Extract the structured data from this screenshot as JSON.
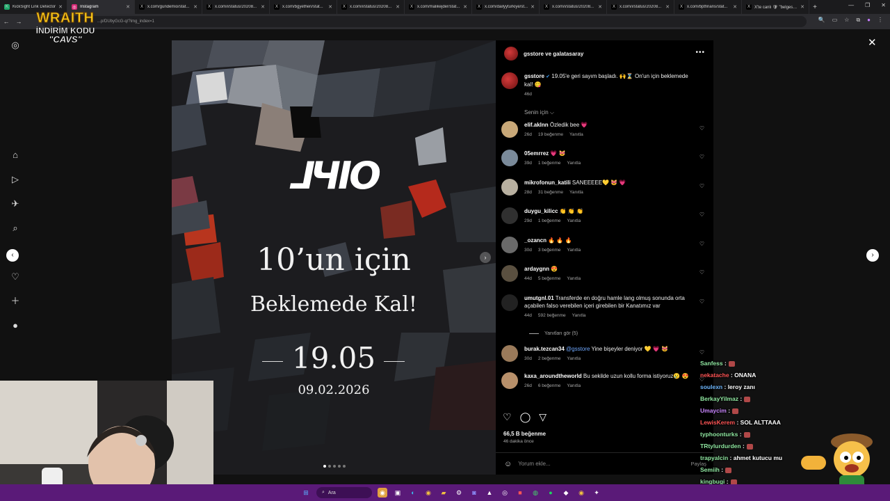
{
  "browser": {
    "tabs": [
      {
        "title": "KickSight Link Detector",
        "fav": "K",
        "color": "#1ea86a"
      },
      {
        "title": "Instagram",
        "fav": "◎",
        "color": "#d62976",
        "active": true
      },
      {
        "title": "x.com/gundemio/stat...",
        "fav": "X",
        "color": "#000000"
      },
      {
        "title": "x.com/i/status/20208...",
        "fav": "X",
        "color": "#000000"
      },
      {
        "title": "x.com/bgyethen/stat...",
        "fav": "X",
        "color": "#000000"
      },
      {
        "title": "x.com/i/status/20208...",
        "fav": "X",
        "color": "#000000"
      },
      {
        "title": "x.com/malikejder/stat...",
        "fav": "X",
        "color": "#000000"
      },
      {
        "title": "x.com/dailyyturkiye/st...",
        "fav": "X",
        "color": "#000000"
      },
      {
        "title": "x.com/i/status/20208...",
        "fav": "X",
        "color": "#000000"
      },
      {
        "title": "x.com/i/status/20208...",
        "fav": "X",
        "color": "#000000"
      },
      {
        "title": "x.com/bptfinans/stat...",
        "fav": "X",
        "color": "#000000"
      },
      {
        "title": "X'te canlı 🛡 \"belgese...",
        "fav": "X",
        "color": "#000000"
      }
    ],
    "url": "...p/DUbyGcG-q/?img_index=1"
  },
  "overlay_brand": {
    "line1": "WRAITH",
    "line2": "İNDİRİM KODU",
    "line3": "\"CAVS\""
  },
  "post_image": {
    "line1": "10’un için",
    "line2": "Beklemede Kal!",
    "date": "19.05",
    "subdate": "09.02.2026"
  },
  "panel": {
    "header": "gsstore ve galatasaray",
    "caption": {
      "user": "gsstore",
      "text": "19.05'e geri sayım başladı. 🙌⌛ On'un için beklemede kal! 😋",
      "age": "46d"
    },
    "senin_icin": "Senin için ⌵",
    "comments": [
      {
        "user": "elif.aklnn",
        "text": "Özledik bee 💗",
        "age": "26d",
        "likes": "19 beğenme",
        "reply": "Yanıtla"
      },
      {
        "user": "05emrrez",
        "text": "💗 😻",
        "age": "39d",
        "likes": "1 beğenme",
        "reply": "Yanıtla"
      },
      {
        "user": "mikrofonun_katili",
        "text": "SANEEEEE💛 😻 💗",
        "age": "28d",
        "likes": "31 beğenme",
        "reply": "Yanıtla"
      },
      {
        "user": "duygu_kilicc",
        "text": "👏 👏 👏",
        "age": "29d",
        "likes": "1 beğenme",
        "reply": "Yanıtla"
      },
      {
        "user": "_ozancn",
        "text": "🔥 🔥 🔥",
        "age": "30d",
        "likes": "3 beğenme",
        "reply": "Yanıtla"
      },
      {
        "user": "ardaygnn",
        "text": "😍",
        "age": "44d",
        "likes": "5 beğenme",
        "reply": "Yanıtla"
      },
      {
        "user": "umutgnl.01",
        "text": "Transferde en doğru hamle lang olmuş sonunda orta açabilen falso verebilen içeri girebilen bir Kanatımız var",
        "age": "44d",
        "likes": "592 beğenme",
        "reply": "Yanıtla"
      },
      {
        "user": "burak.tezcan34",
        "text": "@gsstore Yine bişeyler deniyor 💛 💗 😻",
        "age": "30d",
        "likes": "2 beğenme",
        "reply": "Yanıtla"
      },
      {
        "user": "kaxa_aroundtheworld",
        "text": "Bu sekilde uzun kollu forma istiyoruz😢 😍",
        "age": "26d",
        "likes": "6 beğenme",
        "reply": "Yanıtla"
      }
    ],
    "replies_link": "Yanıtları gör (5)",
    "likes_total": "66,5 B beğenme",
    "posted_ago": "46 dakika önce",
    "add_comment": "Yorum ekle...",
    "share": "Paylaş"
  },
  "chat": [
    {
      "user": "Sanfess",
      "msg": ":",
      "color": "#8fe6a0"
    },
    {
      "user": "nekatache",
      "msg": ": ONANA",
      "color": "#ff5555"
    },
    {
      "user": "soulexn",
      "msg": ": leroy zanı",
      "color": "#6fb8ff"
    },
    {
      "user": "BerkayYilmaz",
      "msg": ":",
      "color": "#8fe6a0"
    },
    {
      "user": "Umaycim",
      "msg": ":",
      "color": "#c987ff"
    },
    {
      "user": "LewisKerem",
      "msg": ": SOL ALTTAAA",
      "color": "#ff5555"
    },
    {
      "user": "typhoonturks",
      "msg": ":",
      "color": "#8fe6a0"
    },
    {
      "user": "TRtylurdurden",
      "msg": ":",
      "color": "#8fe6a0"
    },
    {
      "user": "trapyalcin",
      "msg": ": ahmet kutucu mu",
      "color": "#8fe6a0"
    },
    {
      "user": "Semiih",
      "msg": ":",
      "color": "#8fe6a0"
    },
    {
      "user": "kingbugi",
      "msg": ":",
      "color": "#8fe6a0"
    }
  ],
  "taskbar": {
    "search": "Ara"
  }
}
